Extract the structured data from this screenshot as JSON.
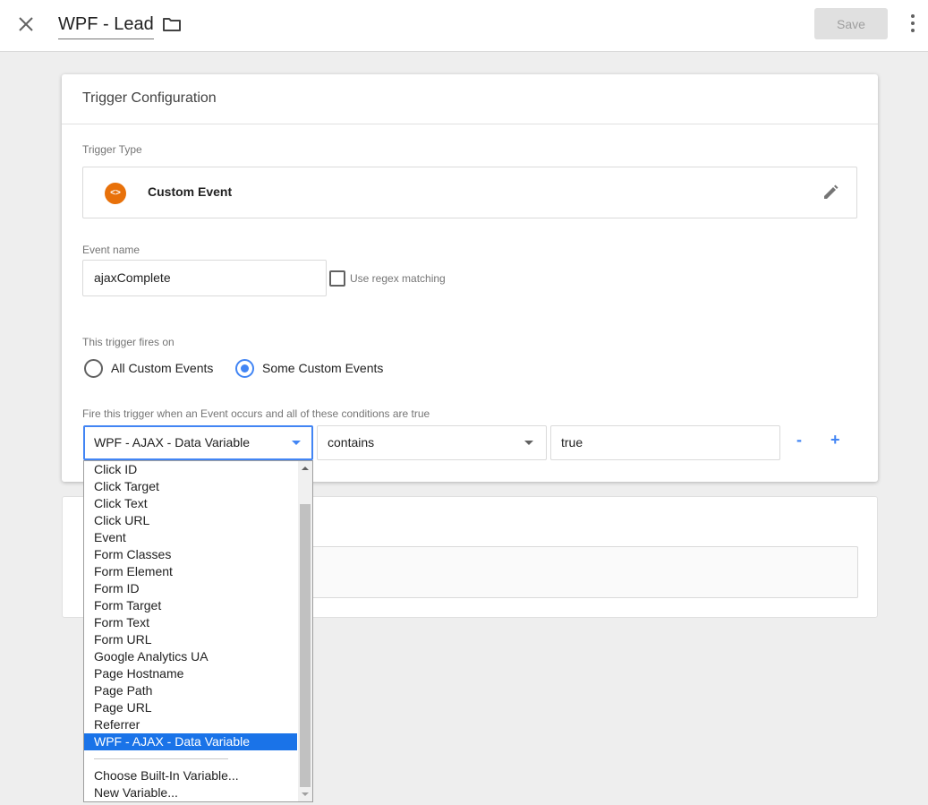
{
  "header": {
    "title": "WPF - Lead",
    "save_label": "Save"
  },
  "card": {
    "heading": "Trigger Configuration",
    "trigger_type_label": "Trigger Type",
    "trigger_type_name": "Custom Event",
    "trigger_type_icon": "code-brackets-icon",
    "event_name_label": "Event name",
    "event_name_value": "ajaxComplete",
    "regex_label": "Use regex matching",
    "fires_on_label": "This trigger fires on",
    "radio_all": "All Custom Events",
    "radio_some": "Some Custom Events",
    "conditions_label": "Fire this trigger when an Event occurs and all of these conditions are true",
    "condition": {
      "variable": "WPF - AJAX - Data Variable",
      "operator": "contains",
      "value": "true"
    },
    "minus": "-",
    "plus": "+"
  },
  "dropdown": {
    "items": [
      "Click ID",
      "Click Target",
      "Click Text",
      "Click URL",
      "Event",
      "Form Classes",
      "Form Element",
      "Form ID",
      "Form Target",
      "Form Text",
      "Form URL",
      "Google Analytics UA",
      "Page Hostname",
      "Page Path",
      "Page URL",
      "Referrer",
      "WPF - AJAX - Data Variable"
    ],
    "selected": "WPF - AJAX - Data Variable",
    "actions": [
      "Choose Built-In Variable...",
      "New Variable..."
    ]
  },
  "colors": {
    "accent": "#4285f4",
    "selected_bg": "#1a73e8",
    "trigger_icon": "#e8710a"
  }
}
